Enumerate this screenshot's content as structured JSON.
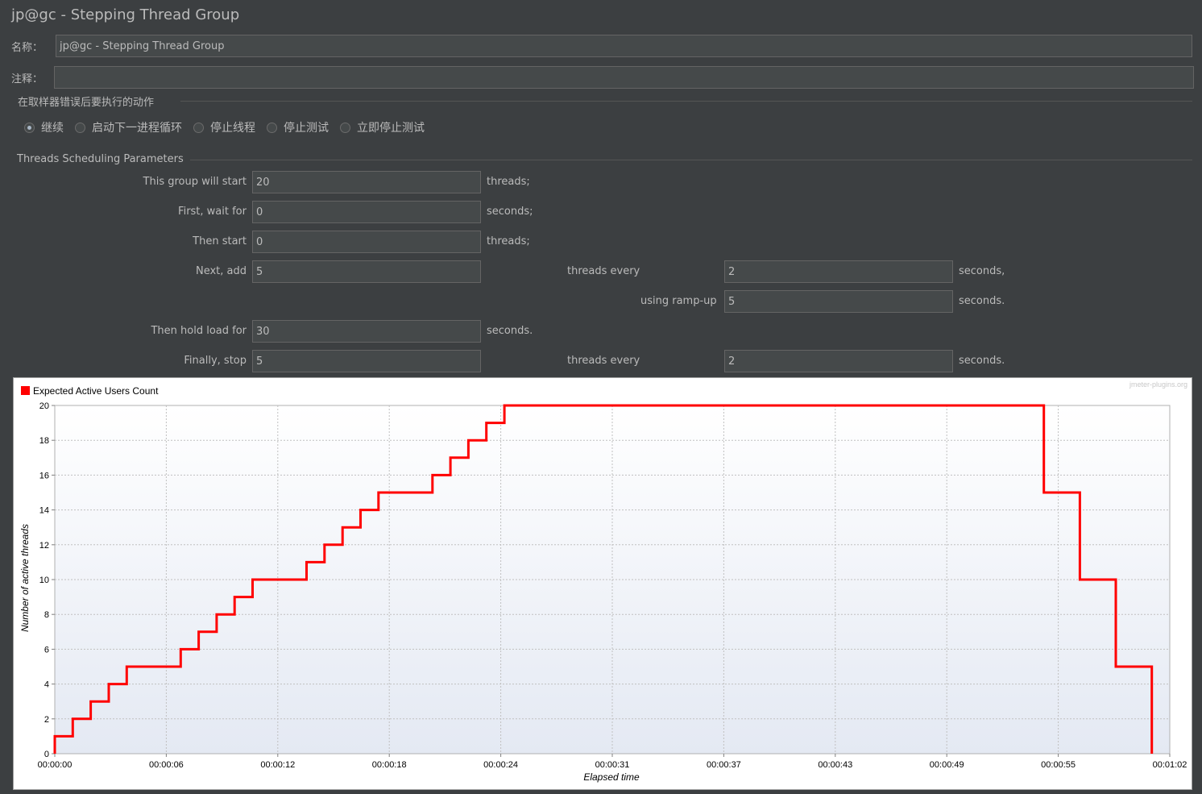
{
  "window": {
    "title": "jp@gc - Stepping Thread Group"
  },
  "name_field": {
    "label": "名称：",
    "value": "jp@gc - Stepping Thread Group"
  },
  "comment_field": {
    "label": "注释：",
    "value": ""
  },
  "error_action": {
    "heading": "在取样器错误后要执行的动作",
    "options": [
      {
        "label": "继续",
        "selected": true
      },
      {
        "label": "启动下一进程循环",
        "selected": false
      },
      {
        "label": "停止线程",
        "selected": false
      },
      {
        "label": "停止测试",
        "selected": false
      },
      {
        "label": "立即停止测试",
        "selected": false
      }
    ]
  },
  "params": {
    "heading": "Threads Scheduling Parameters",
    "start_threads": {
      "label": "This group will start",
      "value": "20",
      "suffix": "threads;"
    },
    "initial_delay": {
      "label": "First, wait for",
      "value": "0",
      "suffix": "seconds;"
    },
    "start_users_count": {
      "label": "Then start",
      "value": "0",
      "suffix": "threads;"
    },
    "next_add": {
      "label": "Next, add",
      "value": "5",
      "mid_label": "threads every",
      "value2": "2",
      "suffix": "seconds,"
    },
    "ramp_up": {
      "label": "using ramp-up",
      "value": "5",
      "suffix": "seconds."
    },
    "hold_load": {
      "label": "Then hold load for",
      "value": "30",
      "suffix": "seconds."
    },
    "finally_stop": {
      "label": "Finally, stop",
      "value": "5",
      "mid_label": "threads every",
      "value2": "2",
      "suffix": "seconds."
    }
  },
  "chart_data": {
    "type": "line",
    "legend": "Expected Active Users Count",
    "watermark": "jmeter-plugins.org",
    "xlabel": "Elapsed time",
    "ylabel": "Number of active threads",
    "xlim": [
      0,
      62
    ],
    "ylim": [
      0,
      20
    ],
    "x_ticks": [
      "00:00:00",
      "00:00:06",
      "00:00:12",
      "00:00:18",
      "00:00:24",
      "00:00:31",
      "00:00:37",
      "00:00:43",
      "00:00:49",
      "00:00:55",
      "00:01:02"
    ],
    "y_ticks": [
      0,
      2,
      4,
      6,
      8,
      10,
      12,
      14,
      16,
      18,
      20
    ],
    "grid": true,
    "color": "#ff0000",
    "series": [
      {
        "x": [
          0,
          0,
          1,
          1,
          2,
          2,
          3,
          3,
          4,
          4,
          7,
          7,
          8,
          8,
          9,
          9,
          10,
          10,
          11,
          11,
          14,
          14,
          15,
          15,
          16,
          16,
          17,
          17,
          18,
          18,
          21,
          21,
          22,
          22,
          23,
          23,
          24,
          24,
          25,
          25,
          55,
          55,
          57,
          57,
          59,
          59,
          61,
          61
        ],
        "y": [
          0,
          1,
          1,
          2,
          2,
          3,
          3,
          4,
          4,
          5,
          5,
          6,
          6,
          7,
          7,
          8,
          8,
          9,
          9,
          10,
          10,
          11,
          11,
          12,
          12,
          13,
          13,
          14,
          14,
          15,
          15,
          16,
          16,
          17,
          17,
          18,
          18,
          19,
          19,
          20,
          20,
          15,
          15,
          10,
          10,
          5,
          5,
          0
        ]
      }
    ]
  }
}
